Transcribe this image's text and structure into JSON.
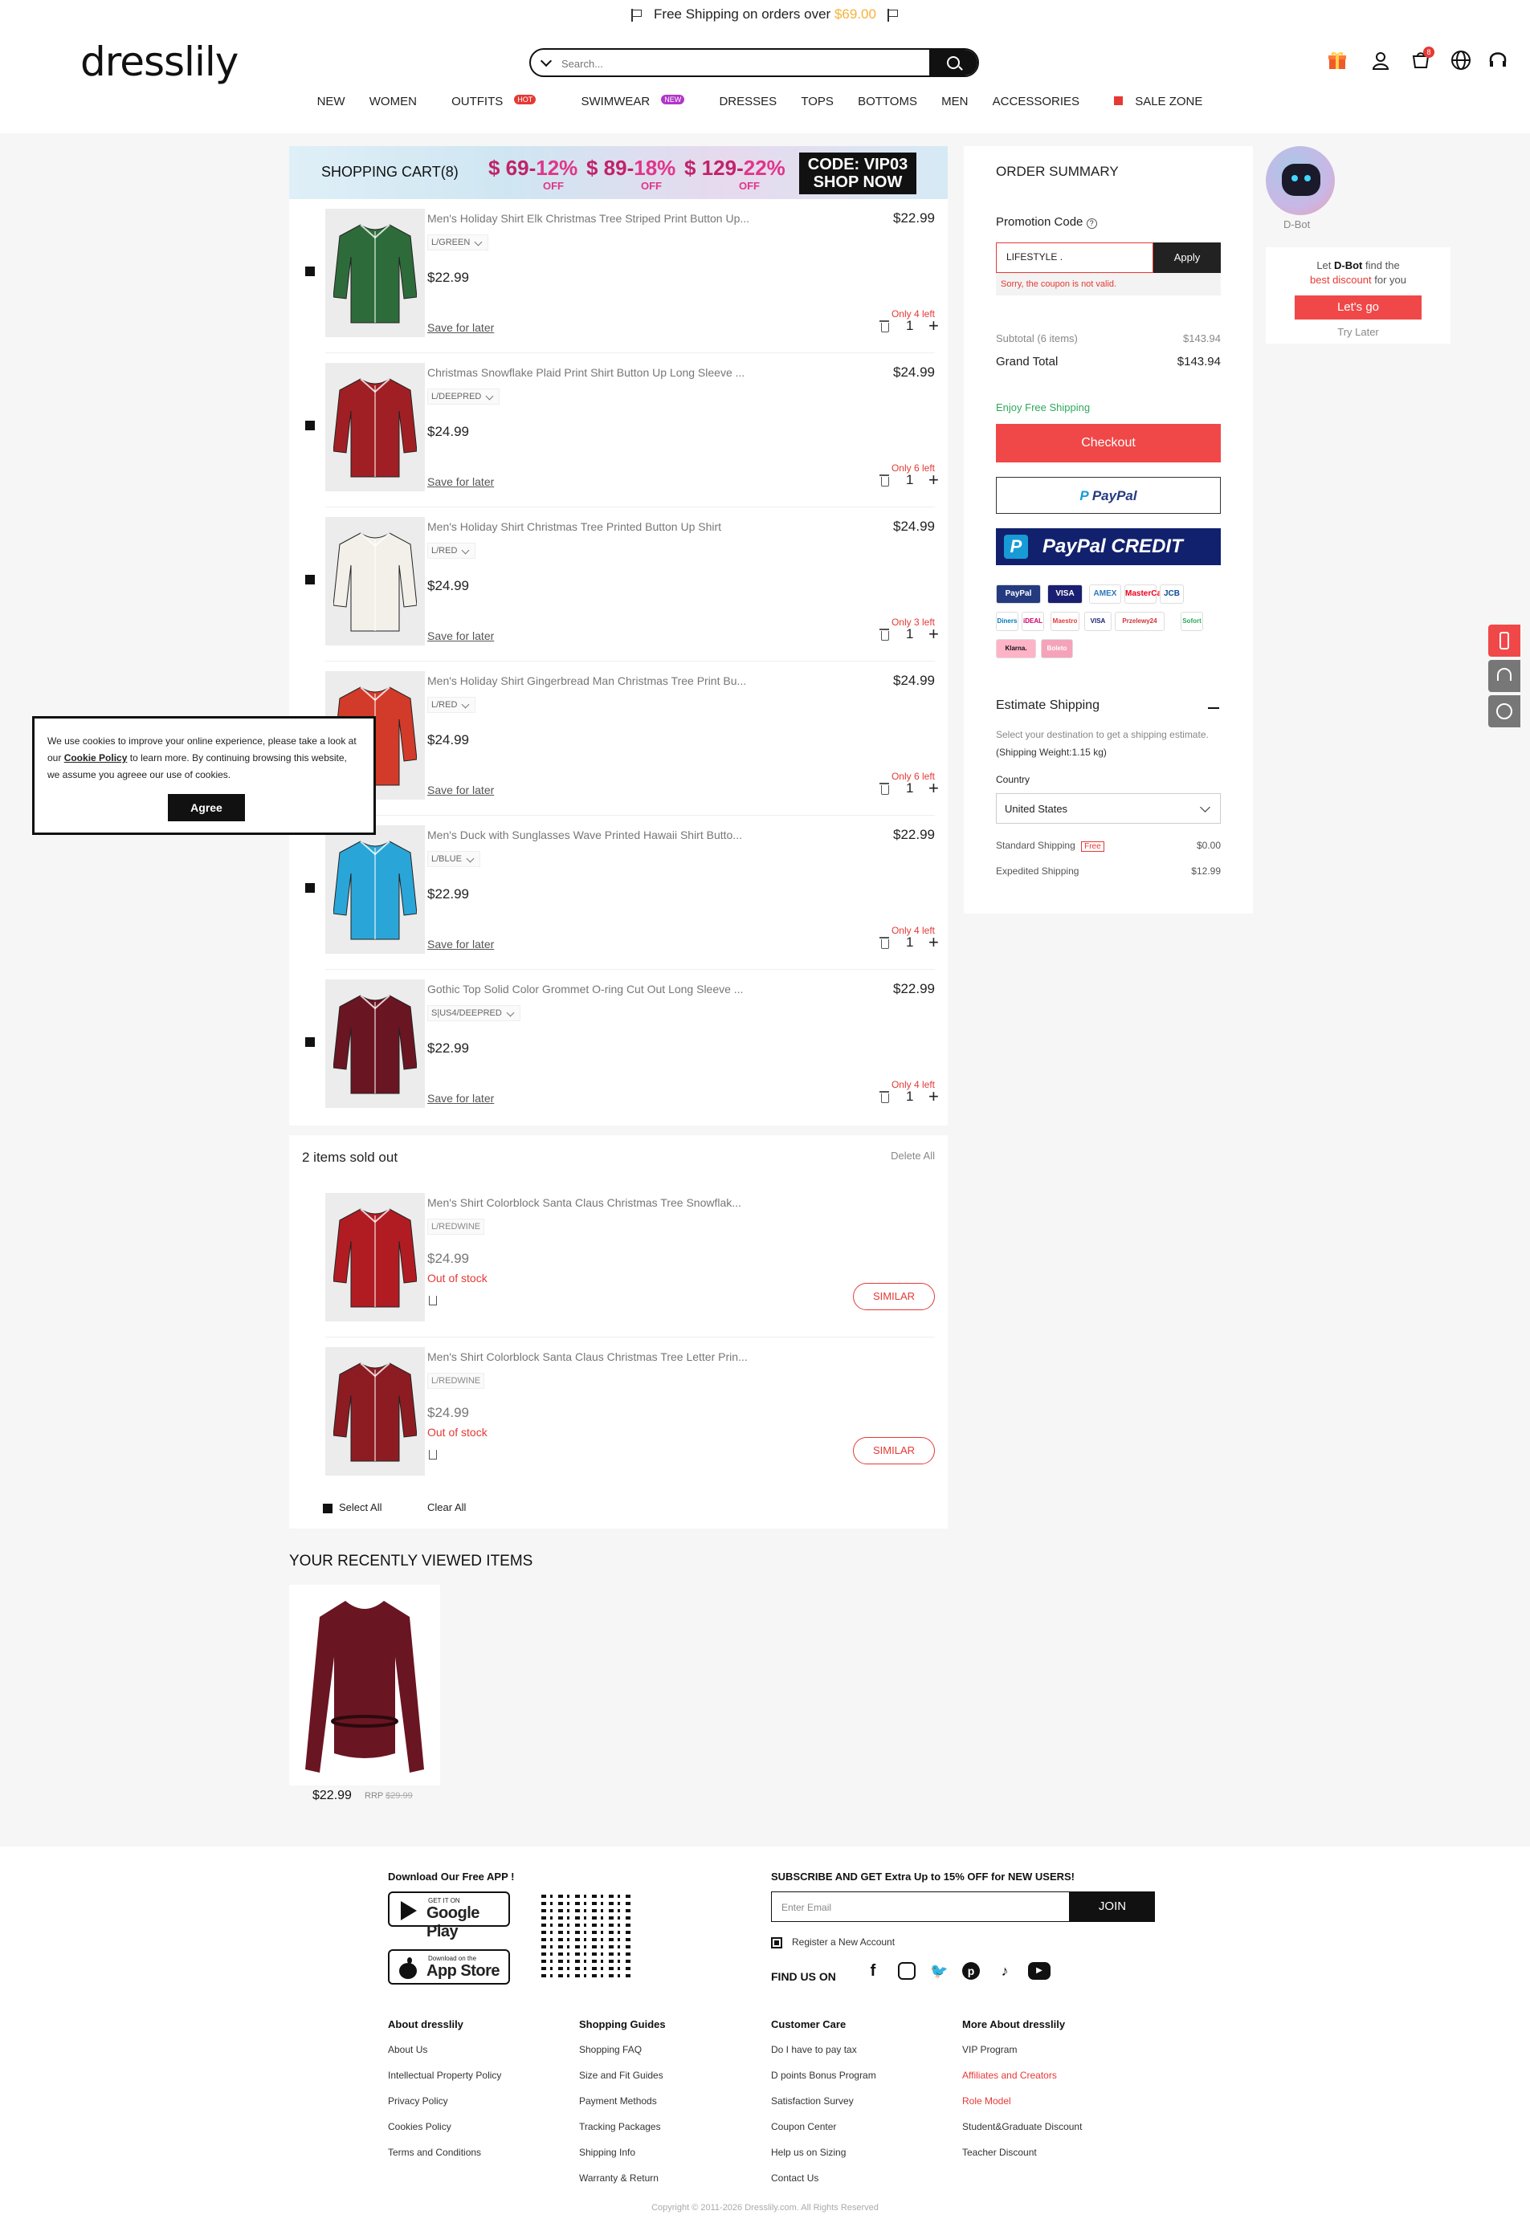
{
  "promo_bar": {
    "text": "Free Shipping on orders over",
    "amount": "$69.00"
  },
  "logo": "dresslily",
  "search": {
    "placeholder": "Search..."
  },
  "cart_badge": "8",
  "nav": [
    {
      "label": "NEW",
      "red": false,
      "badge": ""
    },
    {
      "label": "WOMEN",
      "red": false,
      "badge": ""
    },
    {
      "label": "OUTFITS",
      "red": true,
      "badge": "HOT"
    },
    {
      "label": "SWIMWEAR",
      "red": false,
      "badge": "NEW"
    },
    {
      "label": "DRESSES",
      "red": false,
      "badge": ""
    },
    {
      "label": "TOPS",
      "red": false,
      "badge": ""
    },
    {
      "label": "BOTTOMS",
      "red": false,
      "badge": ""
    },
    {
      "label": "MEN",
      "red": false,
      "badge": ""
    },
    {
      "label": "ACCESSORIES",
      "red": false,
      "badge": ""
    },
    {
      "label": "SALE ZONE",
      "red": true,
      "badge": ""
    }
  ],
  "banner": {
    "title": "SHOPPING CART(8)",
    "tiers": [
      {
        "threshold": "$ 69-",
        "discount": "12%",
        "off": "OFF"
      },
      {
        "threshold": "$ 89-",
        "discount": "18%",
        "off": "OFF"
      },
      {
        "threshold": "$ 129-",
        "discount": "22%",
        "off": "OFF"
      }
    ],
    "code_line1": "CODE: VIP03",
    "code_line2": "SHOP NOW"
  },
  "cart_items": [
    {
      "name": "Men's Holiday Shirt Elk Christmas Tree Striped Print Button Up...",
      "attr": "L/GREEN",
      "price": "$22.99",
      "stock": "Only 4 left",
      "qty": "1",
      "save": "Save for later",
      "color": "#2e6b3a"
    },
    {
      "name": "Christmas Snowflake Plaid Print Shirt Button Up Long Sleeve ...",
      "attr": "L/DEEPRED",
      "price": "$24.99",
      "stock": "Only 6 left",
      "qty": "1",
      "save": "Save for later",
      "color": "#a01f24"
    },
    {
      "name": "Men's Holiday Shirt Christmas Tree Printed Button Up Shirt",
      "attr": "L/RED",
      "price": "$24.99",
      "stock": "Only 3 left",
      "qty": "1",
      "save": "Save for later",
      "color": "#f3efe9"
    },
    {
      "name": "Men's Holiday Shirt Gingerbread Man Christmas Tree Print Bu...",
      "attr": "L/RED",
      "price": "$24.99",
      "stock": "Only 6 left",
      "qty": "1",
      "save": "Save for later",
      "color": "#d23a2a"
    },
    {
      "name": "Men's Duck with Sunglasses Wave Printed Hawaii Shirt Butto...",
      "attr": "L/BLUE",
      "price": "$22.99",
      "stock": "Only 4 left",
      "qty": "1",
      "save": "Save for later",
      "color": "#2aa5d8"
    },
    {
      "name": "Gothic Top Solid Color Grommet O-ring Cut Out Long Sleeve ...",
      "attr": "S|US4/DEEPRED",
      "price": "$22.99",
      "stock": "Only 4 left",
      "qty": "1",
      "save": "Save for later",
      "color": "#6a1522"
    }
  ],
  "sold_out": {
    "title": "2 items sold out",
    "delete_all": "Delete All",
    "items": [
      {
        "name": "Men's Shirt Colorblock Santa Claus Christmas Tree Snowflak...",
        "attr": "L/REDWINE",
        "price": "$24.99",
        "status": "Out of stock",
        "similar": "SIMILAR",
        "color": "#b01c22"
      },
      {
        "name": "Men's Shirt Colorblock Santa Claus Christmas Tree Letter Prin...",
        "attr": "L/REDWINE",
        "price": "$24.99",
        "status": "Out of stock",
        "similar": "SIMILAR",
        "color": "#8c1c22"
      }
    ],
    "select_all": "Select All",
    "clear_all": "Clear All"
  },
  "summary": {
    "title": "ORDER SUMMARY",
    "promo_label": "Promotion Code",
    "promo_value": "LIFESTYLE .",
    "apply": "Apply",
    "error": "Sorry, the coupon is not valid.",
    "subtotal_label": "Subtotal (6 items)",
    "subtotal": "$143.94",
    "grand_label": "Grand Total",
    "grand": "$143.94",
    "free_ship": "Enjoy Free Shipping",
    "checkout": "Checkout",
    "paypal": "PayPal",
    "paypal_credit": "PayPal CREDIT",
    "payment_icons": [
      "PayPal",
      "VISA",
      "AMEX",
      "MasterCard",
      "JCB",
      "Diners",
      "iDEAL",
      "Maestro",
      "VISA",
      "Przelewy24",
      "Sofort",
      "Klarna.",
      "Boleto"
    ],
    "estimate_title": "Estimate Shipping",
    "estimate_text": "Select your destination to get a shipping estimate.",
    "weight": "(Shipping Weight:1.15 kg)",
    "country_label": "Country",
    "country": "United States",
    "shipping": [
      {
        "name": "Standard Shipping",
        "badge": "Free",
        "price": "$0.00"
      },
      {
        "name": "Expedited Shipping",
        "badge": "",
        "price": "$12.99"
      }
    ]
  },
  "bot": {
    "name": "D-Bot",
    "line1": "Let",
    "bold": "D-Bot",
    "line1b": "find the",
    "red": "best discount",
    "line2": "for you",
    "go": "Let's go",
    "later": "Try Later"
  },
  "cookie": {
    "text1": "We use cookies to improve your online experience, please take a look at our",
    "link": "Cookie Policy",
    "text2": "to learn more. By continuing browsing this website, we assume you agreee our use of cookies.",
    "agree": "Agree"
  },
  "recently": {
    "title": "YOUR RECENTLY VIEWED ITEMS",
    "price": "$22.99",
    "rrp_label": "RRP",
    "rrp": "$29.99"
  },
  "footer": {
    "app_title": "Download Our Free APP !",
    "gp_small": "GET IT ON",
    "gp_big": "Google Play",
    "as_small": "Download on the",
    "as_big": "App Store",
    "subscribe": "SUBSCRIBE AND GET Extra Up to 15% OFF for NEW USERS!",
    "email_placeholder": "Enter Email",
    "join": "JOIN",
    "register": "Register a New Account",
    "find_us": "FIND US ON",
    "cols": [
      {
        "title": "About dresslily",
        "links": [
          "About Us",
          "Intellectual Property Policy",
          "Privacy Policy",
          "Cookies Policy",
          "Terms and Conditions"
        ]
      },
      {
        "title": "Shopping Guides",
        "links": [
          "Shopping FAQ",
          "Size and Fit Guides",
          "Payment Methods",
          "Tracking Packages",
          "Shipping Info",
          "Warranty & Return"
        ]
      },
      {
        "title": "Customer Care",
        "links": [
          "Do I have to pay tax",
          "D points Bonus Program",
          "Satisfaction Survey",
          "Coupon Center",
          "Help us on Sizing",
          "Contact Us"
        ]
      },
      {
        "title": "More About dresslily",
        "links": [
          "VIP Program",
          "Affiliates and Creators",
          "Role Model",
          "Student&Graduate Discount",
          "Teacher Discount"
        ]
      }
    ],
    "copyright": "Copyright © 2011-2026 Dresslily.com. All Rights Reserved"
  }
}
